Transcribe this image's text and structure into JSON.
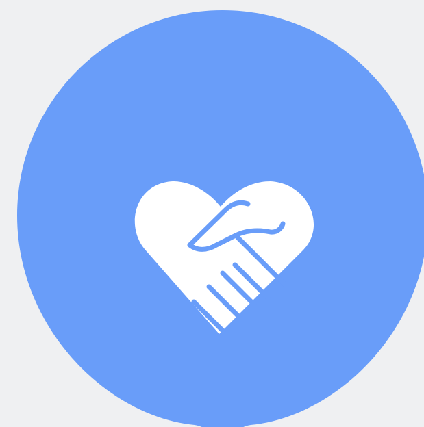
{
  "colors": {
    "background": "#eff0f2",
    "badge_fill": "#699df9",
    "icon_fill": "#ffffff",
    "icon_line": "#699df9"
  },
  "icon": {
    "name": "handshake-heart-icon"
  }
}
